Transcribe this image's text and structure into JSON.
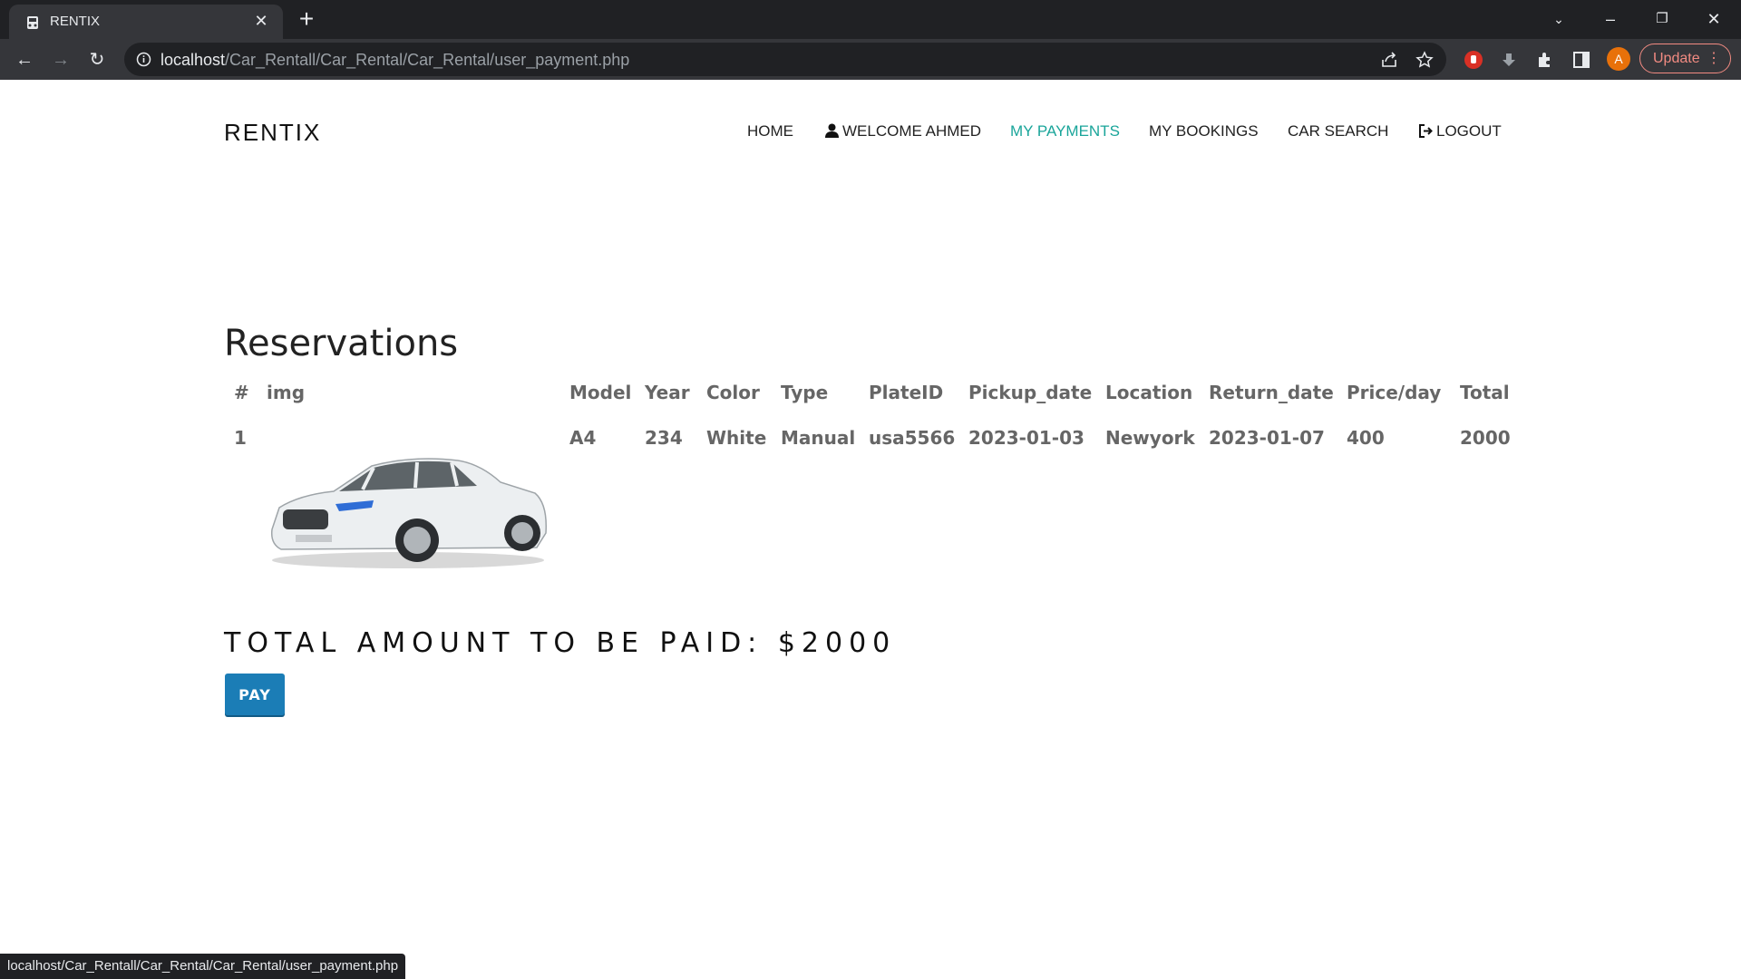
{
  "browser": {
    "tab_title": "RENTIX",
    "url_host": "localhost",
    "url_path": "/Car_Rentall/Car_Rental/Car_Rental/user_payment.php",
    "avatar_initial": "A",
    "update_label": "Update",
    "status_url": "localhost/Car_Rentall/Car_Rental/Car_Rental/user_payment.php"
  },
  "site": {
    "brand": "RENTIX",
    "nav": {
      "home": "HOME",
      "welcome": "WELCOME AHMED",
      "payments": "MY PAYMENTS",
      "bookings": "MY BOOKINGS",
      "search": "CAR SEARCH",
      "logout": "LOGOUT"
    },
    "active_color": "#1aa59a"
  },
  "reservations": {
    "title": "Reservations",
    "headers": [
      "#",
      "img",
      "Model",
      "Year",
      "Color",
      "Type",
      "PlateID",
      "Pickup_date",
      "Location",
      "Return_date",
      "Price/day",
      "Total"
    ],
    "rows": [
      {
        "num": "1",
        "model": "A4",
        "year": "234",
        "color": "White",
        "type": "Manual",
        "plate": "usa5566",
        "pickup": "2023-01-03",
        "location": "Newyork",
        "return": "2023-01-07",
        "price": "400",
        "total": "2000"
      }
    ]
  },
  "payment": {
    "total_text": "TOTAL AMOUNT TO BE PAID: $2000",
    "pay_label": "PAY",
    "pay_color": "#1b7db6"
  }
}
